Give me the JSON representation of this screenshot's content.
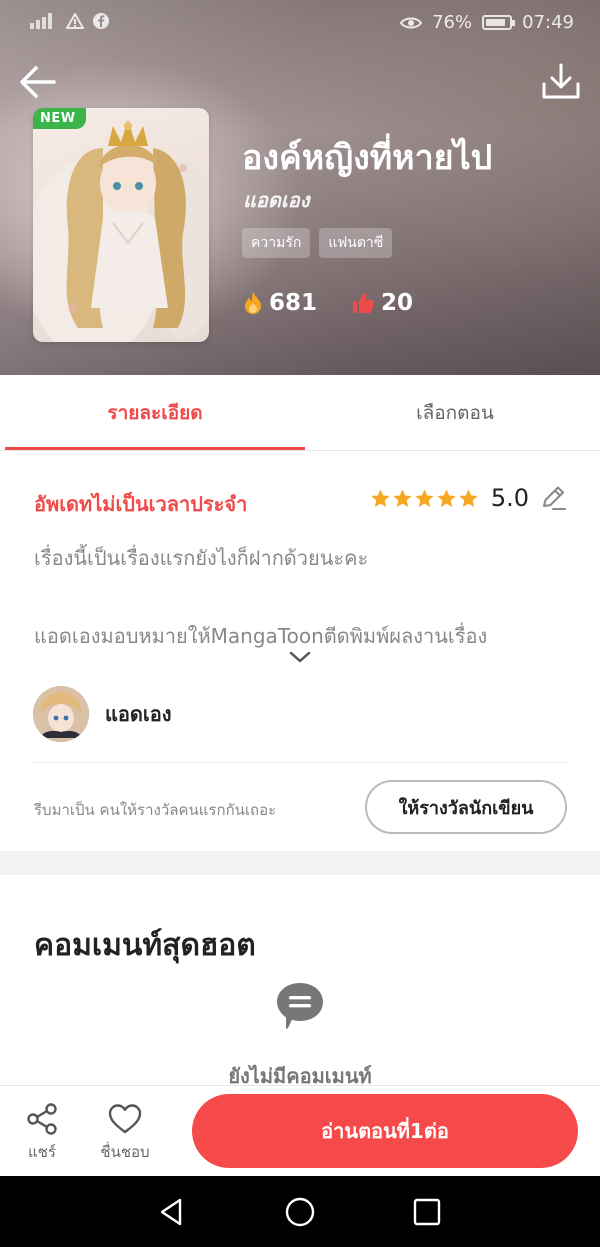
{
  "status_bar": {
    "battery": "76%",
    "time": "07:49"
  },
  "book": {
    "badge": "NEW",
    "title": "องค์หญิงที่หายไป",
    "author": "แอดเอง",
    "tags": [
      "ความรัก",
      "แฟนตาซี"
    ],
    "views": "681",
    "likes": "20"
  },
  "tabs": {
    "detail": "รายละเอียด",
    "episodes": "เลือกตอน"
  },
  "detail": {
    "update_schedule": "อัพเดทไม่เป็นเวลาประจำ",
    "rating": "5.0",
    "rating_stars": 5,
    "description_line1": "เรื่องนี้เป็นเรื่องแรกยังไงก็ฝากด้วยนะคะ",
    "description_line2": "แอดเองมอบหมายให้MangaToonตีดพิมพ์ผลงานเรื่อง",
    "author_name": "แอดเอง",
    "reward_prompt": "รีบมาเป็น คนให้รางวัลคนแรกกันเถอะ",
    "reward_button": "ให้รางวัลนักเขียน"
  },
  "comments": {
    "title": "คอมเมนท์สุดฮอต",
    "empty_text": "ยังไม่มีคอมเมนท์"
  },
  "bottom_bar": {
    "share": "แชร์",
    "like": "ชื่นชอบ",
    "read_button": "อ่านตอนที่1ต่อ"
  },
  "colors": {
    "accent": "#f04b4b",
    "read_button": "#f64a4a",
    "new_badge": "#3bb54a",
    "star": "#f5a623"
  }
}
